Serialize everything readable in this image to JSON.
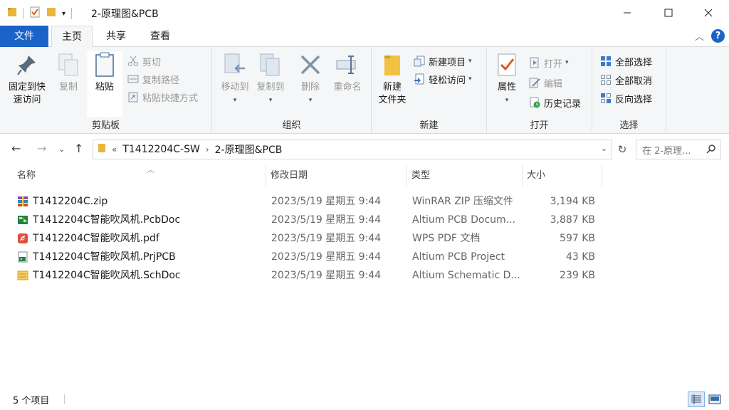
{
  "window": {
    "title": "2-原理图&PCB",
    "accent": "#1b63c6"
  },
  "tabs": {
    "file": "文件",
    "home": "主页",
    "share": "共享",
    "view": "查看"
  },
  "ribbon": {
    "clipboard": {
      "label": "剪贴板",
      "pin_line1": "固定到快",
      "pin_line2": "速访问",
      "copy": "复制",
      "paste": "粘贴",
      "cut": "剪切",
      "copy_path": "复制路径",
      "paste_shortcut": "粘贴快捷方式"
    },
    "organize": {
      "label": "组织",
      "move_to": "移动到",
      "copy_to": "复制到",
      "delete": "删除",
      "rename": "重命名"
    },
    "new": {
      "label": "新建",
      "new_folder_line1": "新建",
      "new_folder_line2": "文件夹",
      "new_item": "新建项目",
      "easy_access": "轻松访问"
    },
    "open": {
      "label": "打开",
      "properties": "属性",
      "open": "打开",
      "edit": "编辑",
      "history": "历史记录"
    },
    "select": {
      "label": "选择",
      "select_all": "全部选择",
      "select_none": "全部取消",
      "invert": "反向选择"
    }
  },
  "address": {
    "overflow": "«",
    "crumbs": [
      "T1412204C-SW",
      "2-原理图&PCB"
    ],
    "search_placeholder": "在 2-原理..."
  },
  "columns": {
    "name": "名称",
    "date": "修改日期",
    "type": "类型",
    "size": "大小"
  },
  "files": [
    {
      "name": "T1412204C.zip",
      "date": "2023/5/19 星期五 9:44",
      "type": "WinRAR ZIP 压缩文件",
      "size": "3,194 KB",
      "icon": "winrar-zip-icon"
    },
    {
      "name": "T1412204C智能吹风机.PcbDoc",
      "date": "2023/5/19 星期五 9:44",
      "type": "Altium PCB Docum...",
      "size": "3,887 KB",
      "icon": "pcb-doc-icon"
    },
    {
      "name": "T1412204C智能吹风机.pdf",
      "date": "2023/5/19 星期五 9:44",
      "type": "WPS PDF 文档",
      "size": "597 KB",
      "icon": "pdf-icon"
    },
    {
      "name": "T1412204C智能吹风机.PrjPCB",
      "date": "2023/5/19 星期五 9:44",
      "type": "Altium PCB Project",
      "size": "43 KB",
      "icon": "pcb-project-icon"
    },
    {
      "name": "T1412204C智能吹风机.SchDoc",
      "date": "2023/5/19 星期五 9:44",
      "type": "Altium Schematic D...",
      "size": "239 KB",
      "icon": "schematic-doc-icon"
    }
  ],
  "status": {
    "count": "5 个项目"
  }
}
